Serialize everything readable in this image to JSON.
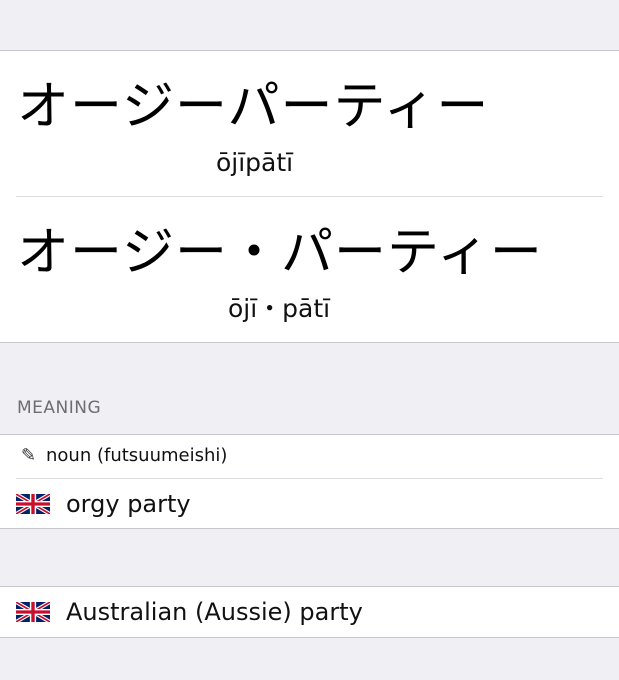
{
  "entries": [
    {
      "kana": "オージーパーティー",
      "romaji": "ōjīpātī"
    },
    {
      "kana": "オージー・パーティー",
      "romaji": "ōjī・pātī"
    }
  ],
  "meaning_section": {
    "header": "MEANING",
    "part_of_speech": {
      "icon": "pencil-icon",
      "label": "noun (futsuumeishi)"
    }
  },
  "definitions": [
    {
      "flag": "uk-flag-icon",
      "text": "orgy party"
    },
    {
      "flag": "uk-flag-icon",
      "text": "Australian (Aussie) party"
    }
  ],
  "colors": {
    "background": "#efeff4",
    "separator": "#c8c7cc",
    "section_header": "#6d6d72"
  }
}
